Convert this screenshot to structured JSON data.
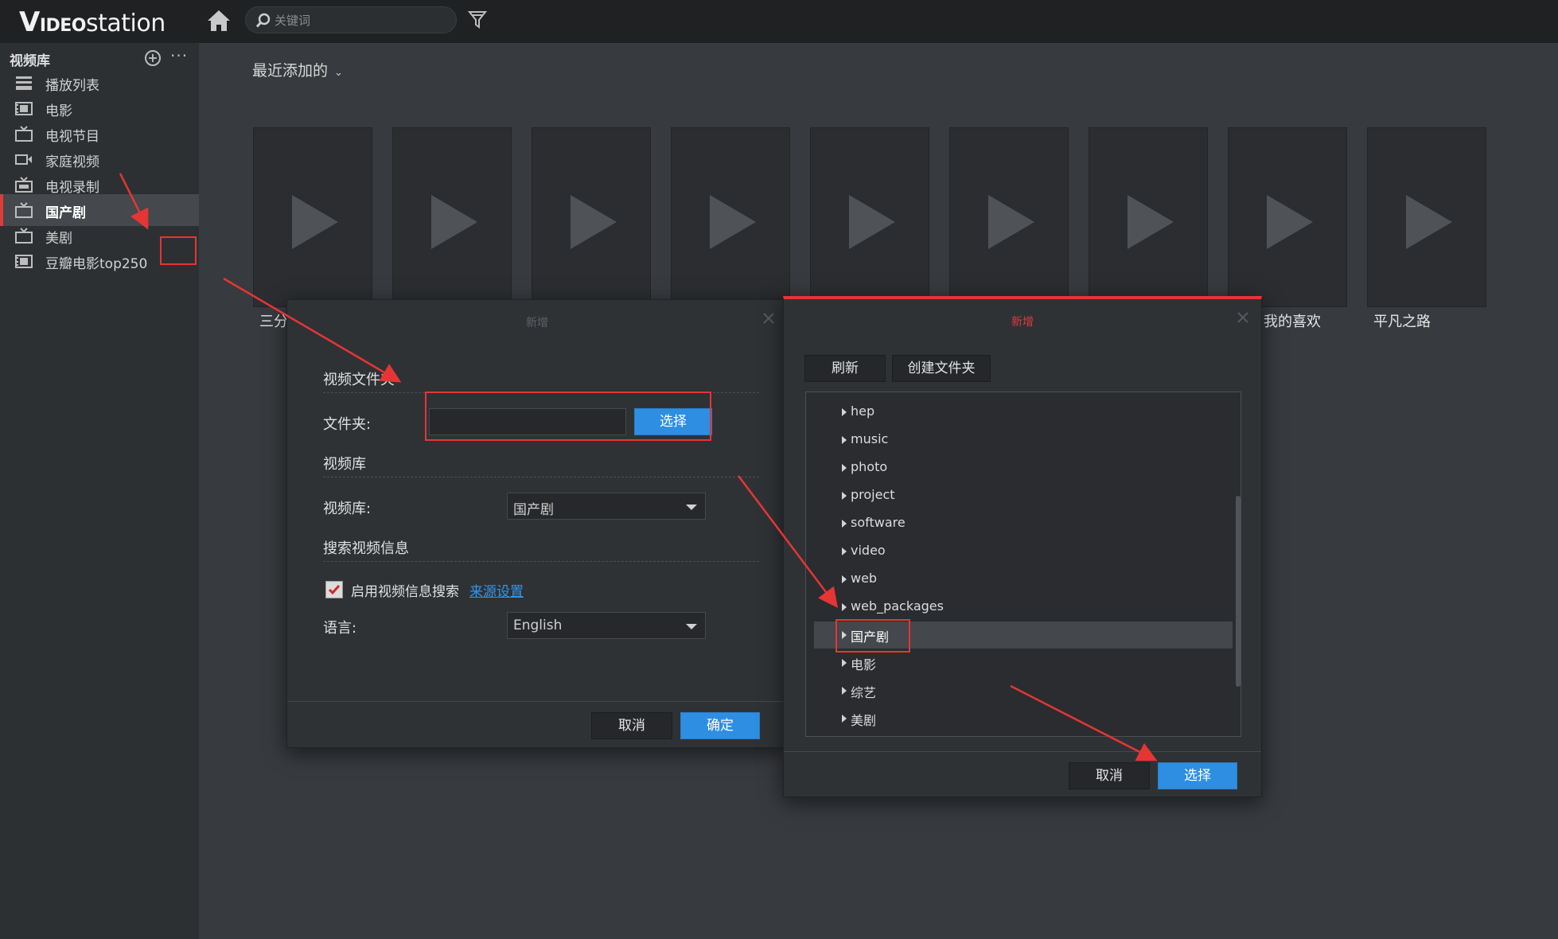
{
  "app": {
    "logo_v": "V",
    "logo_ideo": "IDEO",
    "logo_station": "station",
    "search_placeholder": "关键词"
  },
  "sidebar": {
    "header": "视频库",
    "items": [
      {
        "label": "播放列表",
        "icon": "playlist-icon"
      },
      {
        "label": "电影",
        "icon": "movie-icon"
      },
      {
        "label": "电视节目",
        "icon": "tv-icon"
      },
      {
        "label": "家庭视频",
        "icon": "home-video-icon"
      },
      {
        "label": "电视录制",
        "icon": "tv-record-icon"
      },
      {
        "label": "国产剧",
        "icon": "tv-icon"
      },
      {
        "label": "美剧",
        "icon": "tv-icon"
      },
      {
        "label": "豆瓣电影top250",
        "icon": "movie-icon"
      }
    ],
    "active_index": 5
  },
  "main": {
    "view_title": "最近添加的",
    "visible_labels": [
      "三分",
      "我的喜欢",
      "平凡之路"
    ]
  },
  "dialog_add": {
    "title": "新增",
    "section_folder": "视频文件夹",
    "folder_label": "文件夹:",
    "folder_value": "",
    "select_button": "选择",
    "section_library": "视频库",
    "library_label": "视频库:",
    "library_value": "国产剧",
    "section_search": "搜索视频信息",
    "enable_search_label": "启用视频信息搜索",
    "enable_search_checked": true,
    "source_link": "来源设置",
    "language_label": "语言:",
    "language_value": "English",
    "cancel_button": "取消",
    "ok_button": "确定"
  },
  "dialog_folder": {
    "title": "新增",
    "refresh_button": "刷新",
    "create_folder_button": "创建文件夹",
    "folders": [
      "hep",
      "music",
      "photo",
      "project",
      "software",
      "video",
      "web",
      "web_packages",
      "国产剧",
      "电影",
      "综艺",
      "美剧"
    ],
    "selected_folder": "国产剧",
    "cancel_button": "取消",
    "select_button": "选择"
  },
  "colors": {
    "accent_blue": "#2e8ee2",
    "annotation_red": "#e53535",
    "topbar": "#1f2123",
    "background": "#373a3e"
  }
}
